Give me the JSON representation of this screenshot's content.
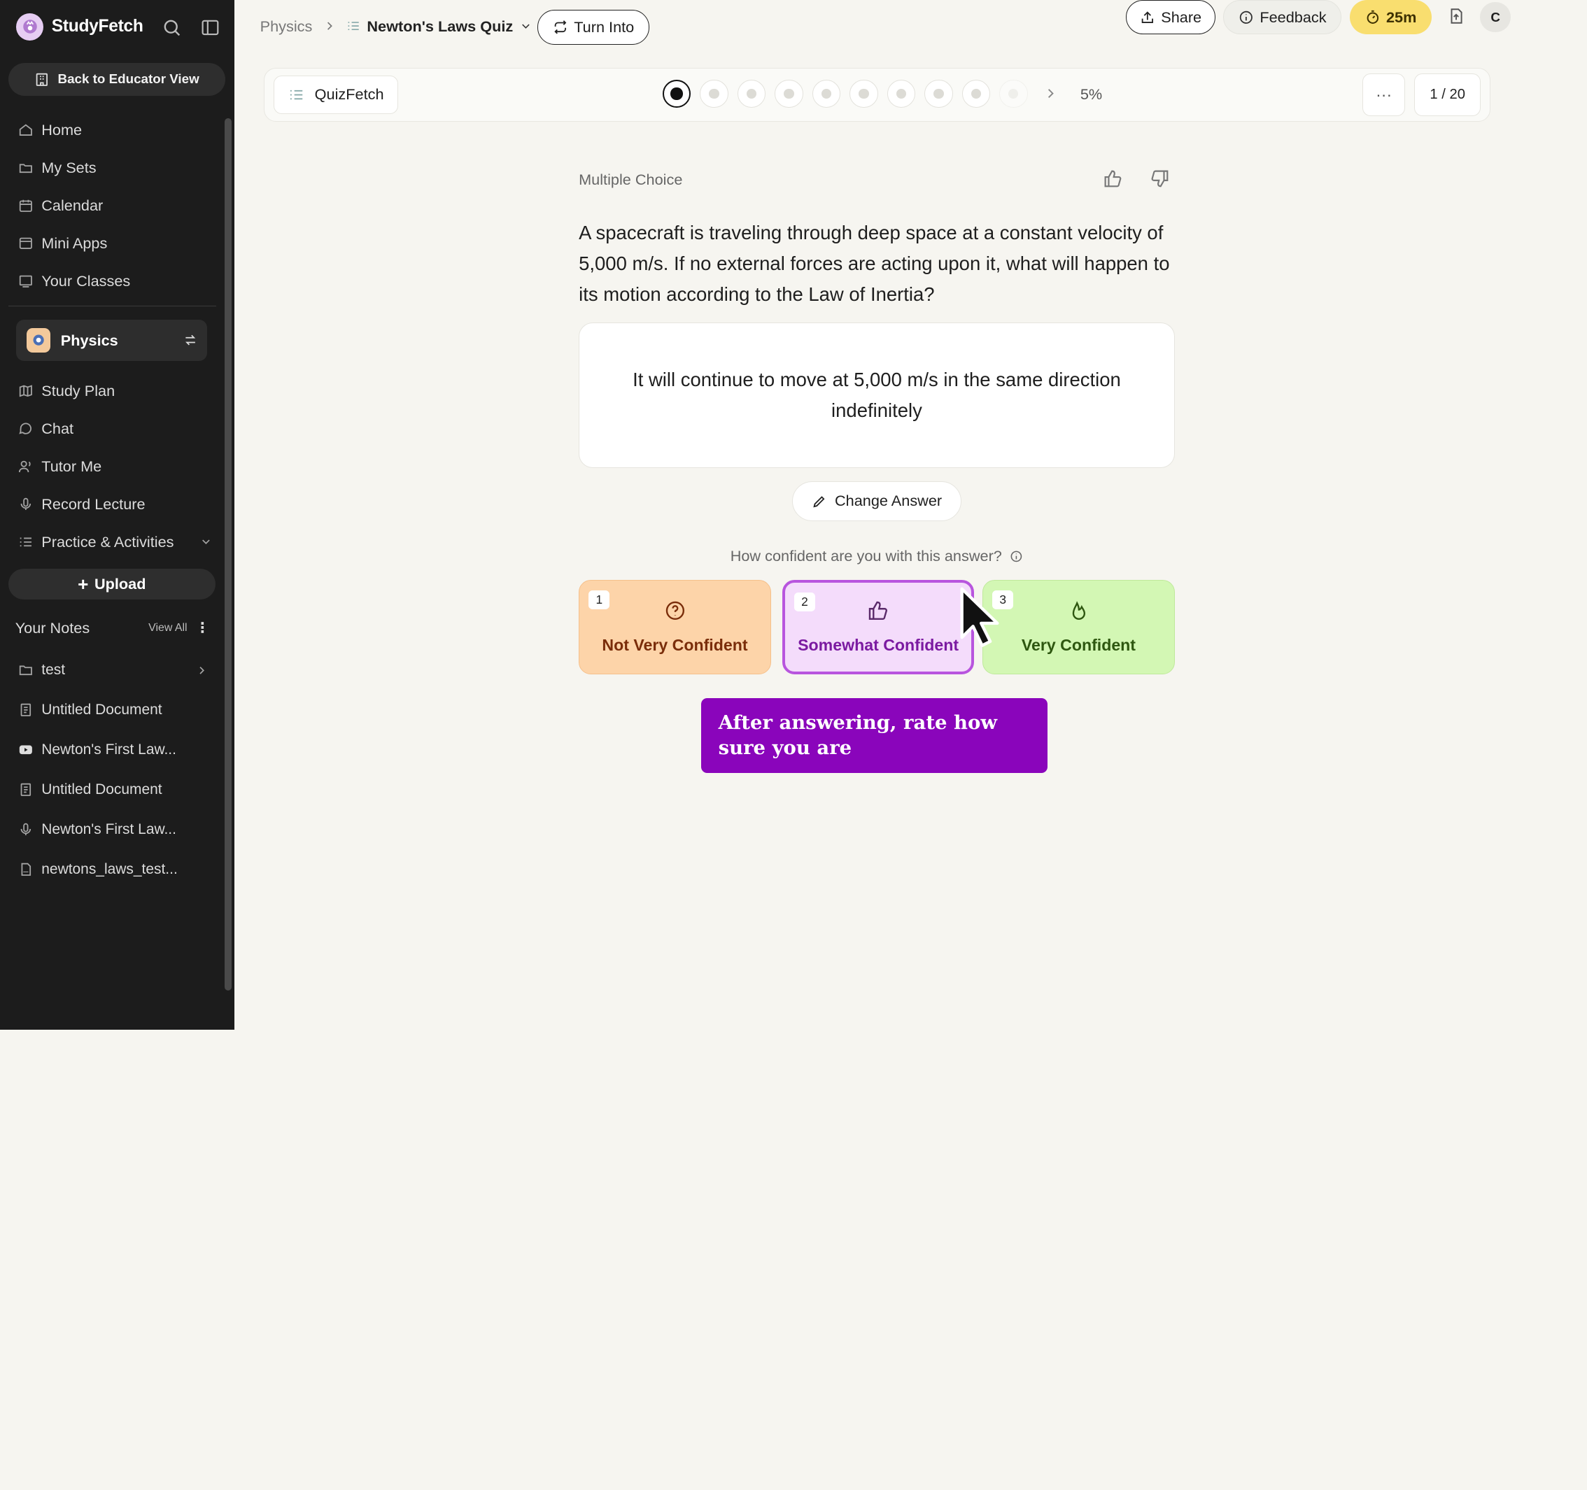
{
  "app": {
    "name": "StudyFetch"
  },
  "sidebar": {
    "back_label": "Back to Educator View",
    "nav": [
      {
        "label": "Home",
        "icon": "home-icon"
      },
      {
        "label": "My Sets",
        "icon": "folders-icon"
      },
      {
        "label": "Calendar",
        "icon": "calendar-icon"
      },
      {
        "label": "Mini Apps",
        "icon": "app-window-icon"
      },
      {
        "label": "Your Classes",
        "icon": "classes-icon"
      }
    ],
    "class_name": "Physics",
    "class_nav": [
      {
        "label": "Study Plan",
        "icon": "map-icon"
      },
      {
        "label": "Chat",
        "icon": "chat-icon"
      },
      {
        "label": "Tutor Me",
        "icon": "tutor-icon"
      },
      {
        "label": "Record Lecture",
        "icon": "mic-icon"
      },
      {
        "label": "Practice & Activities",
        "icon": "list-icon"
      }
    ],
    "upload_label": "Upload",
    "notes_title": "Your Notes",
    "view_all": "View All",
    "notes": [
      {
        "label": "test",
        "icon": "folder-icon"
      },
      {
        "label": "Untitled Document",
        "icon": "document-icon"
      },
      {
        "label": "Newton's First Law...",
        "icon": "youtube-icon"
      },
      {
        "label": "Untitled Document",
        "icon": "document-icon"
      },
      {
        "label": "Newton's First Law...",
        "icon": "mic-icon"
      },
      {
        "label": "newtons_laws_test...",
        "icon": "pdf-icon"
      }
    ]
  },
  "header": {
    "breadcrumb_root": "Physics",
    "quiz_name": "Newton's Laws Quiz",
    "turn_into": "Turn Into",
    "share": "Share",
    "feedback": "Feedback",
    "timer": "25m",
    "avatar": "C"
  },
  "quizbar": {
    "tool_name": "QuizFetch",
    "progress": "5%",
    "counter": "1 / 20",
    "more": "···"
  },
  "question": {
    "type": "Multiple Choice",
    "text": "A spacecraft is traveling through deep space at a constant velocity of 5,000 m/s. If no external forces are acting upon it, what will happen to its motion according to the Law of Inertia?",
    "answer": "It will continue to move at 5,000 m/s in the same direction indefinitely",
    "change_answer": "Change Answer",
    "confidence_prompt": "How confident are you with this answer?",
    "confidence": [
      {
        "num": "1",
        "label": "Not Very Confident"
      },
      {
        "num": "2",
        "label": "Somewhat Confident"
      },
      {
        "num": "3",
        "label": "Very Confident"
      }
    ]
  },
  "tooltip": {
    "text": "After answering, rate how sure you are"
  }
}
